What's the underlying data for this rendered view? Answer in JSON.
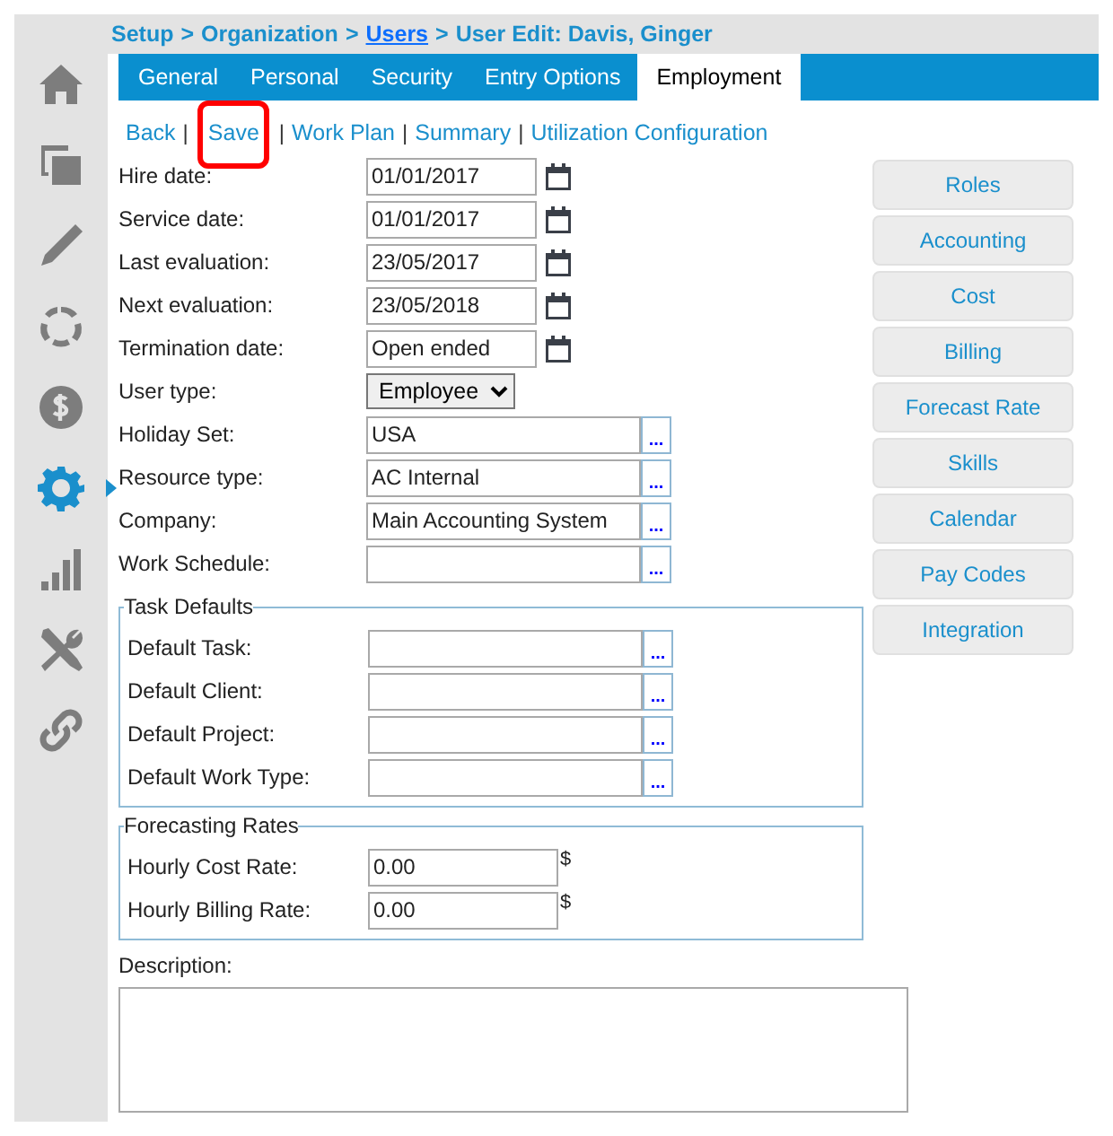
{
  "breadcrumb": [
    {
      "text": "Setup",
      "link": false
    },
    {
      "text": ">",
      "link": false
    },
    {
      "text": "Organization",
      "link": false
    },
    {
      "text": ">",
      "link": false
    },
    {
      "text": "Users",
      "link": true
    },
    {
      "text": ">",
      "link": false
    },
    {
      "text": "User Edit: Davis, Ginger",
      "link": false
    }
  ],
  "sidebar": {
    "items": [
      {
        "selected": false
      },
      {
        "selected": false
      },
      {
        "selected": false
      },
      {
        "selected": false
      },
      {
        "selected": false
      },
      {
        "selected": true
      },
      {
        "selected": false
      },
      {
        "selected": false
      },
      {
        "selected": false
      }
    ]
  },
  "tabs": [
    {
      "label": "General",
      "selected": false
    },
    {
      "label": "Personal",
      "selected": false
    },
    {
      "label": "Security",
      "selected": false
    },
    {
      "label": "Entry Options",
      "selected": false
    },
    {
      "label": "Employment",
      "selected": true
    }
  ],
  "actions": [
    {
      "label": "Back",
      "highlighted": false
    },
    {
      "separator": "|",
      "label": "Save",
      "highlighted": true
    },
    {
      "separator": "|",
      "label": "Work Plan",
      "highlighted": false
    },
    {
      "separator": "|",
      "label": "Summary",
      "highlighted": false
    },
    {
      "separator": "|",
      "label": "Utilization Configuration",
      "highlighted": false
    }
  ],
  "fields": [
    {
      "label": "Hire date:",
      "kind": "date",
      "value": "01/01/2017"
    },
    {
      "label": "Service date:",
      "kind": "date",
      "value": "01/01/2017"
    },
    {
      "label": "Last evaluation:",
      "kind": "date",
      "value": "23/05/2017"
    },
    {
      "label": "Next evaluation:",
      "kind": "date",
      "value": "23/05/2018"
    },
    {
      "label": "Termination date:",
      "kind": "date",
      "value": "Open ended"
    },
    {
      "label": "User type:",
      "kind": "select",
      "value": "Employee"
    },
    {
      "label": "Holiday Set:",
      "kind": "lookup",
      "value": "USA",
      "button": "..."
    },
    {
      "label": "Resource type:",
      "kind": "lookup",
      "value": "AC Internal",
      "button": "..."
    },
    {
      "label": "Company:",
      "kind": "lookup",
      "value": "Main Accounting System",
      "button": "..."
    },
    {
      "label": "Work Schedule:",
      "kind": "lookup",
      "button": "..."
    }
  ],
  "groups": [
    {
      "title": "Task Defaults",
      "fields": [
        {
          "label": "Default Task:",
          "kind": "lookup",
          "button": "..."
        },
        {
          "label": "Default Client:",
          "kind": "lookup",
          "button": "..."
        },
        {
          "label": "Default Project:",
          "kind": "lookup",
          "button": "..."
        },
        {
          "label": "Default Work Type:",
          "kind": "lookup",
          "button": "..."
        }
      ]
    },
    {
      "title": "Forecasting Rates",
      "fields": [
        {
          "label": "Hourly Cost Rate:",
          "kind": "money",
          "value": "0.00",
          "suffix": "$"
        },
        {
          "label": "Hourly Billing Rate:",
          "kind": "money",
          "value": "0.00",
          "suffix": "$"
        }
      ]
    }
  ],
  "description": {
    "label": "Description:"
  },
  "side_buttons": [
    "Roles",
    "Accounting",
    "Cost",
    "Billing",
    "Forecast Rate",
    "Skills",
    "Calendar",
    "Pay Codes",
    "Integration"
  ]
}
